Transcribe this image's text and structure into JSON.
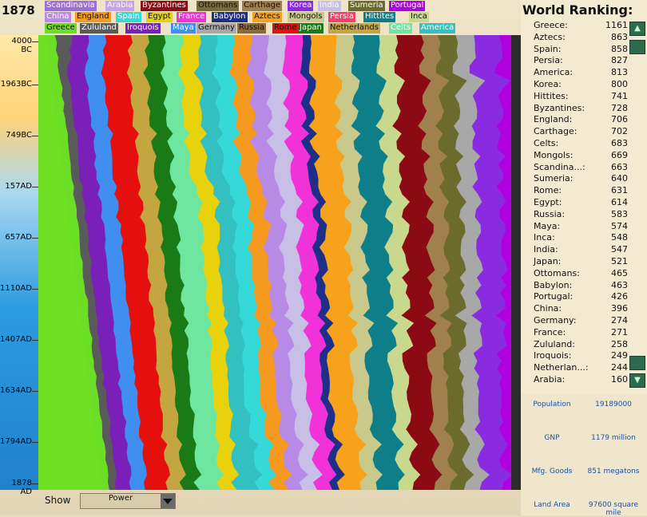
{
  "year": "1878",
  "legend": [
    {
      "name": "Scandinavia",
      "color": "#a06cd6",
      "text": "#ffffff"
    },
    {
      "name": "Arabia",
      "color": "#c9a0f0",
      "text": "#ffffff"
    },
    {
      "name": "Byzantines",
      "color": "#8b0a14",
      "text": "#ffffff"
    },
    {
      "name": "Ottomans",
      "color": "#7a6a38",
      "text": "#111111"
    },
    {
      "name": "Carthage",
      "color": "#a0804c",
      "text": "#111111"
    },
    {
      "name": "Korea",
      "color": "#8a2be2",
      "text": "#ffffff"
    },
    {
      "name": "India",
      "color": "#c8bfe7",
      "text": "#ffffff"
    },
    {
      "name": "Sumeria",
      "color": "#6b6b2e",
      "text": "#ffffff"
    },
    {
      "name": "Portugal",
      "color": "#b000e0",
      "text": "#ffffff"
    },
    {
      "name": "China",
      "color": "#b78ae6",
      "text": "#ffffff"
    },
    {
      "name": "England",
      "color": "#f59a1e",
      "text": "#111111"
    },
    {
      "name": "Spain",
      "color": "#35dad8",
      "text": "#ffffff"
    },
    {
      "name": "Egypt",
      "color": "#e8d20c",
      "text": "#111111"
    },
    {
      "name": "France",
      "color": "#f032d8",
      "text": "#ffffff"
    },
    {
      "name": "Babylon",
      "color": "#1e2f8a",
      "text": "#ffffff"
    },
    {
      "name": "Aztecs",
      "color": "#f7a21a",
      "text": "#111111"
    },
    {
      "name": "Mongols",
      "color": "#c9c98c",
      "text": "#111111"
    },
    {
      "name": "Persia",
      "color": "#f2406a",
      "text": "#ffffff"
    },
    {
      "name": "Hittites",
      "color": "#0e7f88",
      "text": "#ffffff"
    },
    {
      "name": "Inca",
      "color": "#c8d98e",
      "text": "#111111"
    },
    {
      "name": "Greece",
      "color": "#6bdf26",
      "text": "#111111"
    },
    {
      "name": "Zululand",
      "color": "#5a5a5a",
      "text": "#ffffff"
    },
    {
      "name": "Iroquois",
      "color": "#7a1fb8",
      "text": "#ffffff"
    },
    {
      "name": "Maya",
      "color": "#3f8ef0",
      "text": "#ffffff"
    },
    {
      "name": "Germany",
      "color": "#a8a8a8",
      "text": "#111111"
    },
    {
      "name": "Russia",
      "color": "#8f6a2e",
      "text": "#111111"
    },
    {
      "name": "Rome",
      "color": "#e5100e",
      "text": "#111111"
    },
    {
      "name": "Japan",
      "color": "#1a7a16",
      "text": "#ffffff"
    },
    {
      "name": "Netherlands",
      "color": "#c3a640",
      "text": "#111111"
    },
    {
      "name": "Celts",
      "color": "#6fe6a0",
      "text": "#ffffff"
    },
    {
      "name": "America",
      "color": "#32c0c0",
      "text": "#ffffff"
    }
  ],
  "timeline_ticks": [
    "4000 BC",
    "1963BC",
    "749BC",
    "157AD",
    "657AD",
    "1110AD",
    "1407AD",
    "1634AD",
    "1794AD",
    "1878 AD"
  ],
  "ranking": {
    "title": "World Ranking:",
    "items": [
      {
        "name": "Greece:",
        "value": "1161"
      },
      {
        "name": "Aztecs:",
        "value": "863"
      },
      {
        "name": "Spain:",
        "value": "858"
      },
      {
        "name": "Persia:",
        "value": "827"
      },
      {
        "name": "America:",
        "value": "813"
      },
      {
        "name": "Korea:",
        "value": "800"
      },
      {
        "name": "Hittites:",
        "value": "741"
      },
      {
        "name": "Byzantines:",
        "value": "728"
      },
      {
        "name": "England:",
        "value": "706"
      },
      {
        "name": "Carthage:",
        "value": "702"
      },
      {
        "name": "Celts:",
        "value": "683"
      },
      {
        "name": "Mongols:",
        "value": "669"
      },
      {
        "name": "Scandina...:",
        "value": "663"
      },
      {
        "name": "Sumeria:",
        "value": "640"
      },
      {
        "name": "Rome:",
        "value": "631"
      },
      {
        "name": "Egypt:",
        "value": "614"
      },
      {
        "name": "Russia:",
        "value": "583"
      },
      {
        "name": "Maya:",
        "value": "574"
      },
      {
        "name": "Inca:",
        "value": "548"
      },
      {
        "name": "India:",
        "value": "547"
      },
      {
        "name": "Japan:",
        "value": "521"
      },
      {
        "name": "Ottomans:",
        "value": "465"
      },
      {
        "name": "Babylon:",
        "value": "463"
      },
      {
        "name": "Portugal:",
        "value": "426"
      },
      {
        "name": "China:",
        "value": "396"
      },
      {
        "name": "Germany:",
        "value": "274"
      },
      {
        "name": "France:",
        "value": "271"
      },
      {
        "name": "Zululand:",
        "value": "258"
      },
      {
        "name": "Iroquois:",
        "value": "249"
      },
      {
        "name": "Netherlan...:",
        "value": "244"
      },
      {
        "name": "Arabia:",
        "value": "160"
      }
    ],
    "scroll_up_icon": "triangle-up-icon",
    "scroll_down_icon": "triangle-down-icon"
  },
  "stats": [
    {
      "label": "Population",
      "value": "19189000"
    },
    {
      "label": "GNP",
      "value": "1179 million"
    },
    {
      "label": "Mfg. Goods",
      "value": "851 megatons"
    },
    {
      "label": "Land Area",
      "value": "97600 square mile"
    }
  ],
  "show": {
    "label": "Show",
    "value": "Power",
    "dropdown_icon": "chevron-down-icon"
  },
  "chart_bands": [
    {
      "civ": "Greece",
      "color": "#6bdf26",
      "share": [
        1,
        1,
        1,
        1,
        1,
        1,
        1,
        1,
        1,
        1,
        1,
        1
      ]
    },
    {
      "civ": "Zululand",
      "color": "#5a5a5a",
      "share": [
        2,
        1,
        1,
        1,
        1,
        1,
        1,
        1,
        1,
        1,
        1,
        1
      ]
    },
    {
      "civ": "Iroquois",
      "color": "#7a1fb8",
      "share": [
        2,
        2,
        2,
        2,
        2,
        2,
        2,
        2,
        2,
        2,
        2,
        2
      ]
    },
    {
      "civ": "Maya",
      "color": "#3f8ef0",
      "share": [
        2,
        2,
        2,
        2,
        2,
        2,
        2,
        2,
        2,
        2,
        2,
        2
      ]
    },
    {
      "civ": "Rome",
      "color": "#e5100e",
      "share": [
        3,
        3,
        3,
        3,
        3,
        3,
        3,
        3,
        3,
        3,
        3,
        3
      ]
    },
    {
      "civ": "Netherlands",
      "color": "#c3a640",
      "share": [
        2,
        2,
        2,
        2,
        2,
        2,
        2,
        2,
        2,
        2,
        2,
        2
      ]
    },
    {
      "civ": "Japan",
      "color": "#1a7a16",
      "share": [
        2,
        2,
        2,
        2,
        2,
        2,
        2,
        2,
        2,
        2,
        2,
        2
      ]
    },
    {
      "civ": "Celts",
      "color": "#6fe6a0",
      "share": [
        2,
        2,
        2,
        2,
        3,
        3,
        3,
        3,
        3,
        3,
        3,
        3
      ]
    },
    {
      "civ": "Egypt",
      "color": "#e8d20c",
      "share": [
        2,
        2,
        2,
        2,
        2,
        2,
        2,
        2,
        2,
        2,
        2,
        2
      ]
    },
    {
      "civ": "America",
      "color": "#32c0c0",
      "share": [
        2,
        2,
        2,
        2,
        2,
        2,
        2,
        2,
        2,
        2,
        3,
        3
      ]
    },
    {
      "civ": "Spain",
      "color": "#35dad8",
      "share": [
        2,
        2,
        2,
        2,
        2,
        2,
        2,
        2,
        2,
        2,
        2,
        2
      ]
    },
    {
      "civ": "England",
      "color": "#f59a1e",
      "share": [
        2,
        2,
        2,
        2,
        2,
        2,
        2,
        2,
        2,
        2,
        2,
        2
      ]
    },
    {
      "civ": "China",
      "color": "#b78ae6",
      "share": [
        2,
        2,
        2,
        2,
        2,
        2,
        2,
        2,
        2,
        2,
        2,
        2
      ]
    },
    {
      "civ": "India",
      "color": "#c8bfe7",
      "share": [
        2,
        2,
        2,
        2,
        2,
        2,
        2,
        2,
        2,
        2,
        2,
        2
      ]
    },
    {
      "civ": "France",
      "color": "#f032d8",
      "share": [
        2,
        2,
        2,
        2,
        2,
        2,
        2,
        2,
        2,
        2,
        2,
        2
      ]
    },
    {
      "civ": "Babylon",
      "color": "#1e2f8a",
      "share": [
        1,
        1,
        1,
        1,
        1,
        1,
        1,
        1,
        1,
        1,
        1,
        1
      ]
    },
    {
      "civ": "Aztecs",
      "color": "#f7a21a",
      "share": [
        3,
        3,
        3,
        3,
        3,
        3,
        3,
        3,
        3,
        3,
        3,
        3
      ]
    },
    {
      "civ": "Mongols",
      "color": "#c9c98c",
      "share": [
        2,
        2,
        2,
        2,
        2,
        2,
        2,
        2,
        2,
        2,
        2,
        2
      ]
    },
    {
      "civ": "Hittites",
      "color": "#0e7f88",
      "share": [
        3,
        3,
        3,
        3,
        3,
        3,
        3,
        3,
        3,
        3,
        3,
        3
      ]
    },
    {
      "civ": "Inca",
      "color": "#c8d98e",
      "share": [
        2,
        2,
        2,
        2,
        2,
        2,
        2,
        2,
        2,
        2,
        2,
        2
      ]
    },
    {
      "civ": "Byzantines",
      "color": "#8b0a14",
      "share": [
        3,
        3,
        3,
        3,
        3,
        3,
        3,
        3,
        3,
        3,
        3,
        3
      ]
    },
    {
      "civ": "Carthage",
      "color": "#a0804c",
      "share": [
        2,
        2,
        2,
        2,
        2,
        2,
        2,
        2,
        2,
        2,
        2,
        2
      ]
    },
    {
      "civ": "Sumeria",
      "color": "#6b6b2e",
      "share": [
        2,
        2,
        2,
        2,
        2,
        2,
        2,
        2,
        2,
        2,
        2,
        2
      ]
    },
    {
      "civ": "Germany",
      "color": "#a8a8a8",
      "share": [
        2,
        2,
        2,
        2,
        2,
        2,
        2,
        2,
        2,
        2,
        2,
        2
      ]
    },
    {
      "civ": "Korea",
      "color": "#8a2be2",
      "share": [
        3,
        3,
        3,
        3,
        3,
        3,
        3,
        3,
        3,
        3,
        3,
        3
      ]
    },
    {
      "civ": "Portugal",
      "color": "#b000e0",
      "share": [
        1,
        1,
        1,
        1,
        1,
        1,
        1,
        1,
        1,
        1,
        1,
        1
      ]
    }
  ]
}
